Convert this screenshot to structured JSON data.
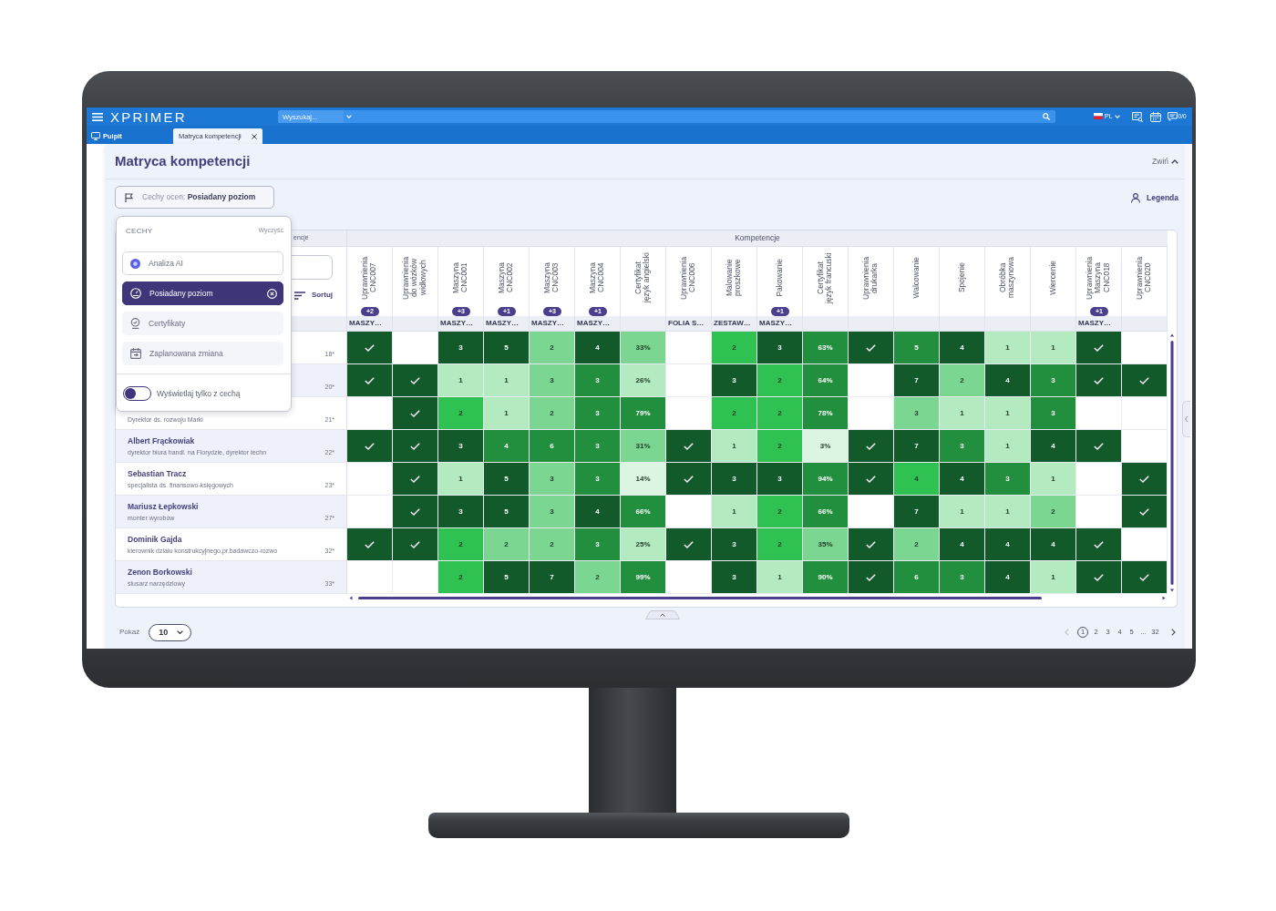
{
  "topbar": {
    "logo": "XPRIMER",
    "search": {
      "placeholder": "Wyszukaj..."
    },
    "language": "PL",
    "messages": "0/0"
  },
  "tabs": [
    {
      "kind": "home",
      "label": "Pulpit",
      "selected": false
    },
    {
      "kind": "document",
      "label": "Matryca kompetencji",
      "selected": true
    }
  ],
  "page": {
    "title": "Matryca kompetencji",
    "collapse": "Zwiń",
    "filter": {
      "label": "Cechy ocen:",
      "value": "Posiadany poziom"
    },
    "legend": "Legenda"
  },
  "features_panel": {
    "title": "CECHY",
    "clear": "Wyczyść",
    "items": [
      {
        "kind": "ai",
        "label": "Analiza AI",
        "selected": false
      },
      {
        "kind": "level",
        "label": "Posiadany poziom",
        "selected": true
      },
      {
        "kind": "certificate",
        "label": "Certyfikaty",
        "selected": false
      },
      {
        "kind": "schedule",
        "label": "Zaplanowana zmiana",
        "selected": false
      }
    ],
    "toggle": {
      "label": "Wyświetlaj tylko z cechą",
      "on": false
    }
  },
  "table": {
    "corner_header": "encje",
    "sort": "Sortuj",
    "group_header": "Kompetencje",
    "columns": [
      {
        "label": "Uprawnienia CNC007",
        "badge": "+2",
        "sub": "MASZY…"
      },
      {
        "label": "Uprawnienia do wózków widłowych"
      },
      {
        "label": "Maszyna CNC001",
        "badge": "+3",
        "sub": "MASZY…"
      },
      {
        "label": "Maszyna CNC002",
        "badge": "+1",
        "sub": "MASZY…"
      },
      {
        "label": "Maszyna CNC003",
        "badge": "+3",
        "sub": "MASZY…"
      },
      {
        "label": "Maszyna CNC004",
        "badge": "+1",
        "sub": "MASZY…"
      },
      {
        "label": "Certyfikat język angielski"
      },
      {
        "label": "Uprawnienia CNC006",
        "sub": "FOLIA S…"
      },
      {
        "label": "Malowanie proszkowe",
        "sub": "ZESTAW…"
      },
      {
        "label": "Pakowanie",
        "badge": "+1",
        "sub": "MASZY…"
      },
      {
        "label": "Certyfikat język francuski"
      },
      {
        "label": "Uprawnienia drukarka"
      },
      {
        "label": "Walcowanie"
      },
      {
        "label": "Spojenie"
      },
      {
        "label": "Obróbka maszynowa"
      },
      {
        "label": "Wiercenie"
      },
      {
        "label": "Uprawnienia Maszyna CNC018",
        "badge": "+1",
        "sub": "MASZY…"
      },
      {
        "label": "Uprawnienia CNC020"
      }
    ],
    "rows": [
      {
        "number": "18*",
        "cells": [
          {
            "kind": "check",
            "color": "#135a2a"
          },
          {
            "kind": "empty"
          },
          {
            "kind": "score",
            "text": "3",
            "color": "#135a2a"
          },
          {
            "kind": "score",
            "text": "5",
            "color": "#135a2a"
          },
          {
            "kind": "score",
            "text": "2",
            "color": "#7ad690"
          },
          {
            "kind": "score",
            "text": "4",
            "color": "#135a2a"
          },
          {
            "kind": "score",
            "text": "33%",
            "color": "#7ad690"
          },
          {
            "kind": "empty"
          },
          {
            "kind": "score",
            "text": "2",
            "color": "#2fc152"
          },
          {
            "kind": "score",
            "text": "3",
            "color": "#135a2a"
          },
          {
            "kind": "score",
            "text": "63%",
            "color": "#228f3e"
          },
          {
            "kind": "check",
            "color": "#135a2a"
          },
          {
            "kind": "score",
            "text": "5",
            "color": "#228f3e"
          },
          {
            "kind": "score",
            "text": "4",
            "color": "#135a2a"
          },
          {
            "kind": "score",
            "text": "1",
            "color": "#b3eabf"
          },
          {
            "kind": "score",
            "text": "1",
            "color": "#b3eabf"
          },
          {
            "kind": "check",
            "color": "#135a2a"
          },
          {
            "kind": "empty"
          }
        ]
      },
      {
        "number": "20*",
        "cells": [
          {
            "kind": "check",
            "color": "#135a2a"
          },
          {
            "kind": "check",
            "color": "#135a2a"
          },
          {
            "kind": "score",
            "text": "1",
            "color": "#b3eabf"
          },
          {
            "kind": "score",
            "text": "1",
            "color": "#b3eabf"
          },
          {
            "kind": "score",
            "text": "3",
            "color": "#7ad690"
          },
          {
            "kind": "score",
            "text": "3",
            "color": "#228f3e"
          },
          {
            "kind": "score",
            "text": "26%",
            "color": "#b3eabf"
          },
          {
            "kind": "empty"
          },
          {
            "kind": "score",
            "text": "3",
            "color": "#135a2a"
          },
          {
            "kind": "score",
            "text": "2",
            "color": "#2fc152"
          },
          {
            "kind": "score",
            "text": "64%",
            "color": "#228f3e"
          },
          {
            "kind": "empty"
          },
          {
            "kind": "score",
            "text": "7",
            "color": "#135a2a"
          },
          {
            "kind": "score",
            "text": "2",
            "color": "#7ad690"
          },
          {
            "kind": "score",
            "text": "4",
            "color": "#135a2a"
          },
          {
            "kind": "score",
            "text": "3",
            "color": "#228f3e"
          },
          {
            "kind": "check",
            "color": "#135a2a"
          },
          {
            "kind": "check",
            "color": "#135a2a"
          }
        ]
      },
      {
        "subtitle": "Dyrektor ds. rozwoju Marki",
        "number": "21*",
        "cells": [
          {
            "kind": "empty"
          },
          {
            "kind": "check",
            "color": "#135a2a"
          },
          {
            "kind": "score",
            "text": "2",
            "color": "#2fc152"
          },
          {
            "kind": "score",
            "text": "1",
            "color": "#b3eabf"
          },
          {
            "kind": "score",
            "text": "2",
            "color": "#7ad690"
          },
          {
            "kind": "score",
            "text": "3",
            "color": "#228f3e"
          },
          {
            "kind": "score",
            "text": "79%",
            "color": "#228f3e"
          },
          {
            "kind": "empty"
          },
          {
            "kind": "score",
            "text": "2",
            "color": "#2fc152"
          },
          {
            "kind": "score",
            "text": "2",
            "color": "#2fc152"
          },
          {
            "kind": "score",
            "text": "78%",
            "color": "#228f3e"
          },
          {
            "kind": "empty"
          },
          {
            "kind": "score",
            "text": "3",
            "color": "#7ad690"
          },
          {
            "kind": "score",
            "text": "1",
            "color": "#b3eabf"
          },
          {
            "kind": "score",
            "text": "1",
            "color": "#b3eabf"
          },
          {
            "kind": "score",
            "text": "3",
            "color": "#228f3e"
          },
          {
            "kind": "empty"
          },
          {
            "kind": "empty"
          }
        ]
      },
      {
        "name": "Albert Frąckowiak",
        "subtitle": "dyrektor biura handl. na Florydzie, dyrektor techn",
        "number": "22*",
        "cells": [
          {
            "kind": "check",
            "color": "#135a2a"
          },
          {
            "kind": "check",
            "color": "#135a2a"
          },
          {
            "kind": "score",
            "text": "3",
            "color": "#135a2a"
          },
          {
            "kind": "score",
            "text": "4",
            "color": "#228f3e"
          },
          {
            "kind": "score",
            "text": "6",
            "color": "#228f3e"
          },
          {
            "kind": "score",
            "text": "3",
            "color": "#228f3e"
          },
          {
            "kind": "score",
            "text": "31%",
            "color": "#7ad690"
          },
          {
            "kind": "check",
            "color": "#135a2a"
          },
          {
            "kind": "score",
            "text": "1",
            "color": "#b3eabf"
          },
          {
            "kind": "score",
            "text": "2",
            "color": "#2fc152"
          },
          {
            "kind": "score",
            "text": "3%",
            "color": "#dcf5e2"
          },
          {
            "kind": "check",
            "color": "#135a2a"
          },
          {
            "kind": "score",
            "text": "7",
            "color": "#135a2a"
          },
          {
            "kind": "score",
            "text": "3",
            "color": "#228f3e"
          },
          {
            "kind": "score",
            "text": "1",
            "color": "#b3eabf"
          },
          {
            "kind": "score",
            "text": "4",
            "color": "#135a2a"
          },
          {
            "kind": "check",
            "color": "#135a2a"
          },
          {
            "kind": "empty"
          }
        ]
      },
      {
        "name": "Sebastian Tracz",
        "subtitle": "specjalista ds. finansowo-księgowych",
        "number": "23*",
        "cells": [
          {
            "kind": "empty"
          },
          {
            "kind": "check",
            "color": "#135a2a"
          },
          {
            "kind": "score",
            "text": "1",
            "color": "#b3eabf"
          },
          {
            "kind": "score",
            "text": "5",
            "color": "#135a2a"
          },
          {
            "kind": "score",
            "text": "3",
            "color": "#7ad690"
          },
          {
            "kind": "score",
            "text": "3",
            "color": "#228f3e"
          },
          {
            "kind": "score",
            "text": "14%",
            "color": "#dcf5e2"
          },
          {
            "kind": "check",
            "color": "#135a2a"
          },
          {
            "kind": "score",
            "text": "3",
            "color": "#135a2a"
          },
          {
            "kind": "score",
            "text": "3",
            "color": "#135a2a"
          },
          {
            "kind": "score",
            "text": "94%",
            "color": "#228f3e"
          },
          {
            "kind": "check",
            "color": "#135a2a"
          },
          {
            "kind": "score",
            "text": "4",
            "color": "#2fc152"
          },
          {
            "kind": "score",
            "text": "4",
            "color": "#135a2a"
          },
          {
            "kind": "score",
            "text": "3",
            "color": "#228f3e"
          },
          {
            "kind": "score",
            "text": "1",
            "color": "#b3eabf"
          },
          {
            "kind": "empty"
          },
          {
            "kind": "check",
            "color": "#135a2a"
          }
        ]
      },
      {
        "name": "Mariusz Łepkowski",
        "subtitle": "monter wyrobów",
        "number": "27*",
        "cells": [
          {
            "kind": "empty"
          },
          {
            "kind": "check",
            "color": "#135a2a"
          },
          {
            "kind": "score",
            "text": "3",
            "color": "#135a2a"
          },
          {
            "kind": "score",
            "text": "5",
            "color": "#135a2a"
          },
          {
            "kind": "score",
            "text": "3",
            "color": "#7ad690"
          },
          {
            "kind": "score",
            "text": "4",
            "color": "#135a2a"
          },
          {
            "kind": "score",
            "text": "66%",
            "color": "#228f3e"
          },
          {
            "kind": "empty"
          },
          {
            "kind": "score",
            "text": "1",
            "color": "#b3eabf"
          },
          {
            "kind": "score",
            "text": "2",
            "color": "#2fc152"
          },
          {
            "kind": "score",
            "text": "66%",
            "color": "#228f3e"
          },
          {
            "kind": "empty"
          },
          {
            "kind": "score",
            "text": "7",
            "color": "#135a2a"
          },
          {
            "kind": "score",
            "text": "1",
            "color": "#b3eabf"
          },
          {
            "kind": "score",
            "text": "1",
            "color": "#b3eabf"
          },
          {
            "kind": "score",
            "text": "2",
            "color": "#7ad690"
          },
          {
            "kind": "empty"
          },
          {
            "kind": "check",
            "color": "#135a2a"
          }
        ]
      },
      {
        "name": "Dominik Gajda",
        "subtitle": "kierownik działu konstrukcyjnego,pr.badawczo-rozwo",
        "number": "32*",
        "cells": [
          {
            "kind": "check",
            "color": "#135a2a"
          },
          {
            "kind": "check",
            "color": "#135a2a"
          },
          {
            "kind": "score",
            "text": "2",
            "color": "#2fc152"
          },
          {
            "kind": "score",
            "text": "2",
            "color": "#7ad690"
          },
          {
            "kind": "score",
            "text": "2",
            "color": "#7ad690"
          },
          {
            "kind": "score",
            "text": "3",
            "color": "#228f3e"
          },
          {
            "kind": "score",
            "text": "25%",
            "color": "#b3eabf"
          },
          {
            "kind": "check",
            "color": "#135a2a"
          },
          {
            "kind": "score",
            "text": "3",
            "color": "#135a2a"
          },
          {
            "kind": "score",
            "text": "2",
            "color": "#2fc152"
          },
          {
            "kind": "score",
            "text": "35%",
            "color": "#7ad690"
          },
          {
            "kind": "check",
            "color": "#135a2a"
          },
          {
            "kind": "score",
            "text": "2",
            "color": "#7ad690"
          },
          {
            "kind": "score",
            "text": "4",
            "color": "#135a2a"
          },
          {
            "kind": "score",
            "text": "4",
            "color": "#135a2a"
          },
          {
            "kind": "score",
            "text": "4",
            "color": "#135a2a"
          },
          {
            "kind": "check",
            "color": "#135a2a"
          },
          {
            "kind": "empty"
          }
        ]
      },
      {
        "name": "Zenon Borkowski",
        "subtitle": "ślusarz narzędziowy",
        "number": "33*",
        "cells": [
          {
            "kind": "empty"
          },
          {
            "kind": "empty"
          },
          {
            "kind": "score",
            "text": "2",
            "color": "#2fc152"
          },
          {
            "kind": "score",
            "text": "5",
            "color": "#135a2a"
          },
          {
            "kind": "score",
            "text": "7",
            "color": "#135a2a"
          },
          {
            "kind": "score",
            "text": "2",
            "color": "#7ad690"
          },
          {
            "kind": "score",
            "text": "99%",
            "color": "#228f3e"
          },
          {
            "kind": "empty"
          },
          {
            "kind": "score",
            "text": "3",
            "color": "#135a2a"
          },
          {
            "kind": "score",
            "text": "1",
            "color": "#b3eabf"
          },
          {
            "kind": "score",
            "text": "90%",
            "color": "#228f3e"
          },
          {
            "kind": "check",
            "color": "#135a2a"
          },
          {
            "kind": "score",
            "text": "6",
            "color": "#228f3e"
          },
          {
            "kind": "score",
            "text": "3",
            "color": "#228f3e"
          },
          {
            "kind": "score",
            "text": "4",
            "color": "#135a2a"
          },
          {
            "kind": "score",
            "text": "1",
            "color": "#b3eabf"
          },
          {
            "kind": "check",
            "color": "#135a2a"
          },
          {
            "kind": "check",
            "color": "#135a2a"
          }
        ]
      }
    ]
  },
  "footer": {
    "show_label": "Pokaż",
    "page_size": "10",
    "prev": {
      "disabled": true
    },
    "next": {
      "disabled": false
    },
    "pages": [
      {
        "label": "1",
        "selected": true
      },
      {
        "label": "2",
        "selected": false
      },
      {
        "label": "3",
        "selected": false
      },
      {
        "label": "4",
        "selected": false
      },
      {
        "label": "5",
        "selected": false
      },
      {
        "label": "...",
        "selected": false
      },
      {
        "label": "32",
        "selected": false
      }
    ]
  }
}
